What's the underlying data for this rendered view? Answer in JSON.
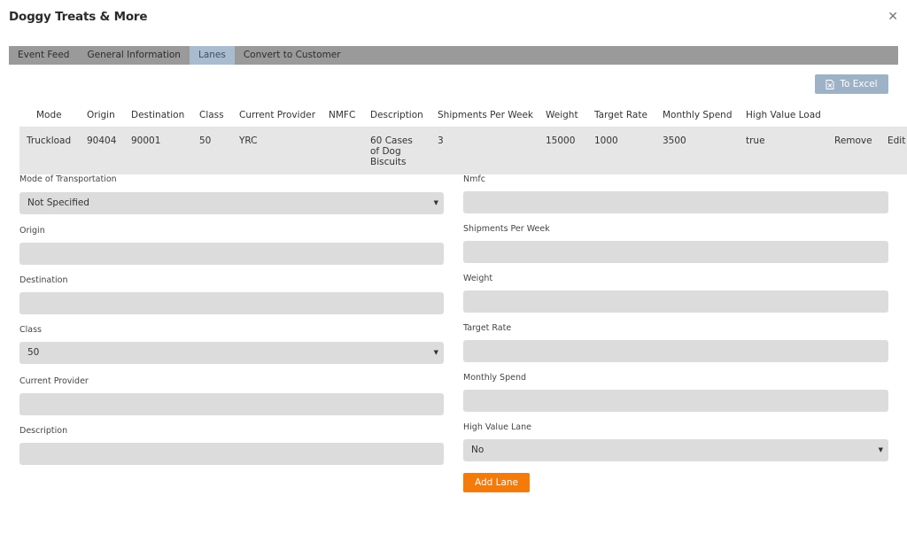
{
  "modal": {
    "title": "Doggy Treats & More",
    "close_glyph": "✕"
  },
  "tabs": [
    {
      "label": "Event Feed",
      "active": false
    },
    {
      "label": "General Information",
      "active": false
    },
    {
      "label": "Lanes",
      "active": true
    },
    {
      "label": "Convert to Customer",
      "active": false
    }
  ],
  "toolbar": {
    "excel_label": "To Excel",
    "excel_icon": "excel-file-icon"
  },
  "table": {
    "headers": [
      "Mode",
      "Origin",
      "Destination",
      "Class",
      "Current Provider",
      "NMFC",
      "Description",
      "Shipments Per Week",
      "Weight",
      "Target Rate",
      "Monthly Spend",
      "High Value Load"
    ],
    "rows": [
      {
        "mode": "Truckload",
        "origin": "90404",
        "destination": "90001",
        "class": "50",
        "provider": "YRC",
        "nmfc": "",
        "description": "60 Cases of Dog Biscuits",
        "shipments": "3",
        "weight": "15000",
        "target_rate": "1000",
        "monthly_spend": "3500",
        "high_value": "true",
        "remove": "Remove",
        "edit": "Edit"
      }
    ]
  },
  "form": {
    "mode_label": "Mode of Transportation",
    "mode_value": "Not Specified",
    "origin_label": "Origin",
    "origin_value": "",
    "destination_label": "Destination",
    "destination_value": "",
    "class_label": "Class",
    "class_value": "50",
    "provider_label": "Current Provider",
    "provider_value": "",
    "description_label": "Description",
    "description_value": "",
    "nmfc_label": "Nmfc",
    "nmfc_value": "",
    "shipments_label": "Shipments Per Week",
    "shipments_value": "",
    "weight_label": "Weight",
    "weight_value": "",
    "target_rate_label": "Target Rate",
    "target_rate_value": "",
    "monthly_spend_label": "Monthly Spend",
    "monthly_spend_value": "",
    "high_value_label": "High Value Lane",
    "high_value_value": "No",
    "add_label": "Add Lane"
  },
  "colors": {
    "accent": "#f47b0a",
    "tab_active": "#a9bccf",
    "tab_bar": "#9a9a9a",
    "excel": "#9db2c7"
  }
}
